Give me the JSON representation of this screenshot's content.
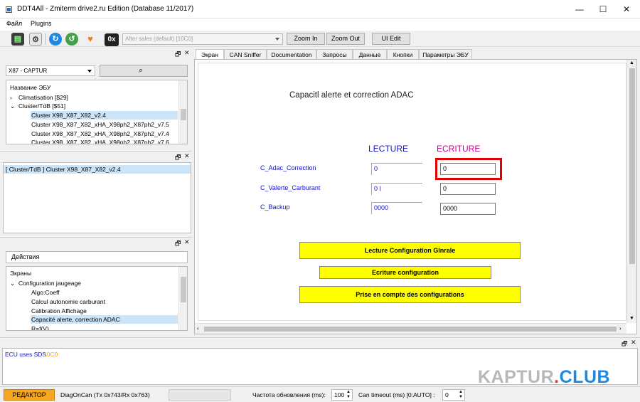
{
  "window": {
    "title": "DDT4All - Zmiterm drive2.ru Edition (Database 11/2017)",
    "min": "—",
    "max": "☐",
    "close": "✕"
  },
  "menu": [
    "Файл",
    "Plugins"
  ],
  "toolbar": {
    "hex_label": "0x",
    "session_placeholder": "After sales (default) [10C0]",
    "zoom_in": "Zoom In",
    "zoom_out": "Zoom Out",
    "ui_edit": "UI Edit"
  },
  "vehicle_select": "X87 - CAPTUR",
  "dock_controls": {
    "float": "🗗",
    "close": "✕"
  },
  "ecu_tree": {
    "header": "Название ЭБУ",
    "items": [
      {
        "expand": "›",
        "label": "Climatisation [$29]"
      },
      {
        "expand": "⌄",
        "label": "Cluster/TdB [$51]"
      },
      {
        "expand": "",
        "label": "Cluster X98_X87_X82_v2.4"
      },
      {
        "expand": "",
        "label": "Cluster X98_X87_X82_xHA_X98ph2_X87ph2_v7.5"
      },
      {
        "expand": "",
        "label": "Cluster X98_X87_X82_xHA_X98ph2_X87ph2_v7.4"
      },
      {
        "expand": "",
        "label": "Cluster X98_X87_X82_xHA_X98ph2_X87ph2_v7.6"
      }
    ]
  },
  "ecu_selected": "[ Cluster/TdB ] Cluster X98_X87_X82_v2.4",
  "actions_label": "Действия",
  "screens_tree": {
    "header": "Экраны",
    "items": [
      {
        "expand": "⌄",
        "label": "Configuration jaugeage"
      },
      {
        "expand": "",
        "label": "Algo:Coeff"
      },
      {
        "expand": "",
        "label": "Calcul autonomie carburant"
      },
      {
        "expand": "",
        "label": "Calibration Affichage"
      },
      {
        "expand": "",
        "label": "Capacité alerte, correction ADAC"
      },
      {
        "expand": "",
        "label": "R=f(V)"
      }
    ]
  },
  "tabs": [
    "Экран",
    "CAN Sniffer",
    "Documentation",
    "Запросы",
    "Данные",
    "Кнопки",
    "Параметры ЭБУ"
  ],
  "screen": {
    "title": "Capacitl alerte et correction ADAC",
    "col_read": "LECTURE",
    "col_write": "ECRITURE",
    "rows": [
      {
        "name": "C_Adac_Correction",
        "read": "0",
        "write": "0"
      },
      {
        "name": "C_Valerte_Carburant",
        "read": "0 l",
        "write": "0"
      },
      {
        "name": "C_Backup",
        "read": "0000",
        "write": "0000"
      }
    ],
    "buttons": [
      "Lecture Configuration Glnrale",
      "Ecriture configuration",
      "Prise en compte des configurations"
    ]
  },
  "log": {
    "text": "ECU uses SDS",
    "code": "10C0"
  },
  "watermark": {
    "part1": "KAPTUR",
    "dot": ".",
    "part2": "CLUB"
  },
  "status": {
    "editor": "РЕДАКТОР",
    "can": "DiagOnCan (Tx 0x743/Rx 0x763)",
    "rate_label": "Частота обновления (ms):",
    "rate_value": "100",
    "timeout_label": "Can timeout (ms) [0:AUTO] :",
    "timeout_value": "0"
  },
  "colors": {
    "read_header": "#1a1ac8",
    "write_header": "#cc0099",
    "highlight": "#e00000",
    "action_button": "#ffff00",
    "editor_badge": "#f5a623"
  }
}
